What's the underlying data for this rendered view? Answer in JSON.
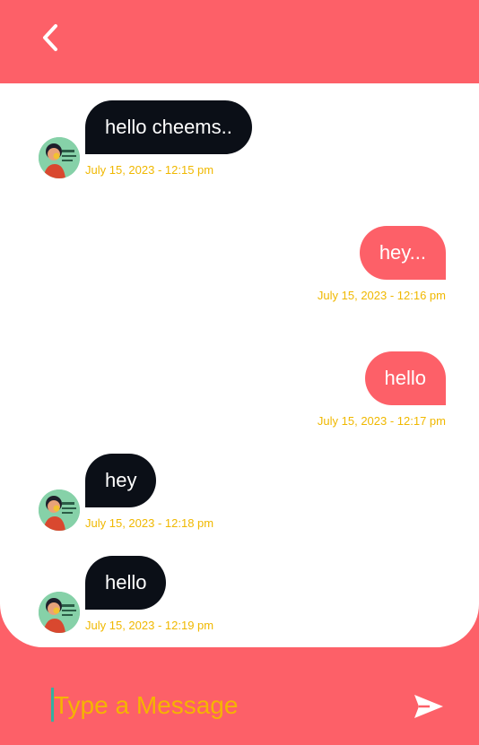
{
  "header": {
    "back_icon": "chevron-left-icon"
  },
  "messages": [
    {
      "direction": "in",
      "text": "hello cheems..",
      "time": "July 15, 2023 - 12:15 pm"
    },
    {
      "direction": "out",
      "text": "hey...",
      "time": "July 15, 2023 - 12:16 pm"
    },
    {
      "direction": "out",
      "text": "hello",
      "time": "July 15, 2023 - 12:17 pm"
    },
    {
      "direction": "in",
      "text": "hey",
      "time": "July 15, 2023 - 12:18 pm"
    },
    {
      "direction": "in",
      "text": "hello",
      "time": "July 15, 2023 - 12:19 pm"
    }
  ],
  "composer": {
    "placeholder": "Type a Message",
    "send_icon": "send-icon"
  },
  "colors": {
    "accent": "#fd6068",
    "incoming_bubble": "#0b0f17",
    "timestamp": "#f0b800",
    "placeholder": "#f5b400"
  }
}
